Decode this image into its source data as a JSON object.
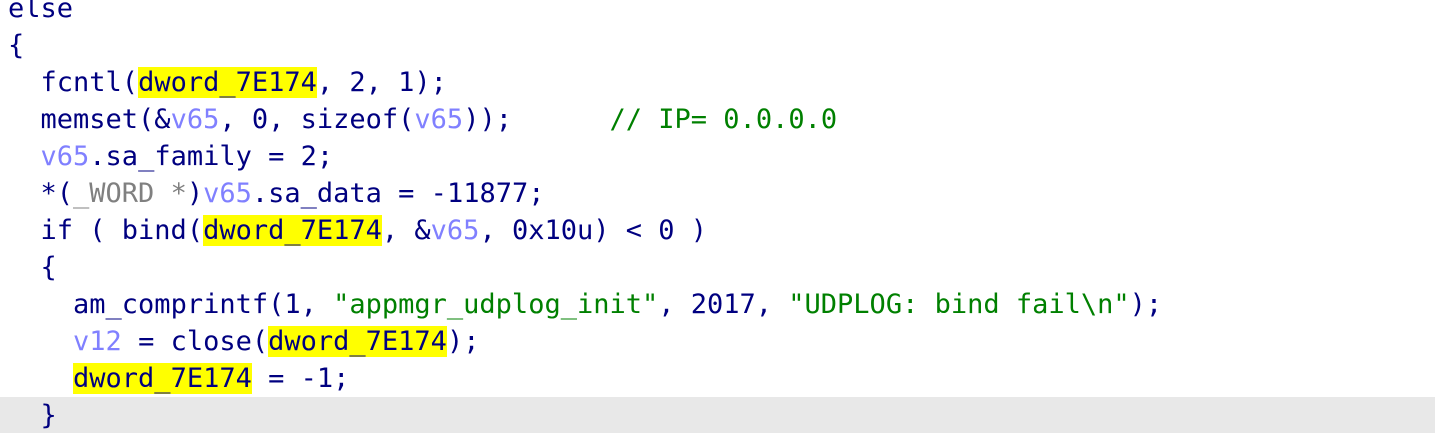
{
  "editor": {
    "lines": [
      {
        "indent": "",
        "current": false,
        "tokens": [
          {
            "text": "else",
            "kind": "ident",
            "name": "keyword-else"
          }
        ]
      },
      {
        "indent": "",
        "current": false,
        "tokens": [
          {
            "text": "{",
            "kind": "punct",
            "name": "brace-open"
          }
        ]
      },
      {
        "indent": "  ",
        "current": false,
        "tokens": [
          {
            "text": "fcntl(",
            "kind": "ident",
            "name": "call-fcntl"
          },
          {
            "text": "dword_7E174",
            "kind": "hl",
            "name": "highlighted-identifier"
          },
          {
            "text": ", 2, 1);",
            "kind": "punct",
            "name": "arguments"
          }
        ]
      },
      {
        "indent": "  ",
        "current": false,
        "tokens": [
          {
            "text": "memset(&",
            "kind": "ident",
            "name": "call-memset"
          },
          {
            "text": "v65",
            "kind": "var",
            "name": "local-variable"
          },
          {
            "text": ", 0, sizeof(",
            "kind": "punct",
            "name": "arguments"
          },
          {
            "text": "v65",
            "kind": "var",
            "name": "local-variable"
          },
          {
            "text": "));      ",
            "kind": "punct",
            "name": "statement-end"
          },
          {
            "text": "// IP= 0.0.0.0",
            "kind": "comment",
            "name": "comment"
          }
        ]
      },
      {
        "indent": "  ",
        "current": false,
        "tokens": [
          {
            "text": "v65",
            "kind": "var",
            "name": "local-variable"
          },
          {
            "text": ".sa_family = 2;",
            "kind": "ident",
            "name": "assignment"
          }
        ]
      },
      {
        "indent": "  ",
        "current": false,
        "tokens": [
          {
            "text": "*(",
            "kind": "punct",
            "name": "cast-open"
          },
          {
            "text": "_WORD *",
            "kind": "type",
            "name": "type-cast"
          },
          {
            "text": ")",
            "kind": "punct",
            "name": "cast-close"
          },
          {
            "text": "v65",
            "kind": "var",
            "name": "local-variable"
          },
          {
            "text": ".sa_data = -11877;",
            "kind": "ident",
            "name": "assignment"
          }
        ]
      },
      {
        "indent": "  ",
        "current": false,
        "tokens": [
          {
            "text": "if ( bind(",
            "kind": "ident",
            "name": "call-bind"
          },
          {
            "text": "dword_7E174",
            "kind": "hl",
            "name": "highlighted-identifier"
          },
          {
            "text": ", &",
            "kind": "punct",
            "name": "arguments"
          },
          {
            "text": "v65",
            "kind": "var",
            "name": "local-variable"
          },
          {
            "text": ", 0x10u) < 0 )",
            "kind": "punct",
            "name": "condition-end"
          }
        ]
      },
      {
        "indent": "  ",
        "current": false,
        "tokens": [
          {
            "text": "{",
            "kind": "punct",
            "name": "brace-open"
          }
        ]
      },
      {
        "indent": "    ",
        "current": false,
        "tokens": [
          {
            "text": "am_comprintf(1, ",
            "kind": "ident",
            "name": "call-am-comprintf"
          },
          {
            "text": "\"appmgr_udplog_init\"",
            "kind": "str",
            "name": "string-literal"
          },
          {
            "text": ", 2017, ",
            "kind": "punct",
            "name": "arguments"
          },
          {
            "text": "\"UDPLOG: bind fail\\n\"",
            "kind": "str",
            "name": "string-literal"
          },
          {
            "text": ");",
            "kind": "punct",
            "name": "statement-end"
          }
        ]
      },
      {
        "indent": "    ",
        "current": false,
        "tokens": [
          {
            "text": "v12",
            "kind": "var",
            "name": "local-variable"
          },
          {
            "text": " = close(",
            "kind": "ident",
            "name": "call-close"
          },
          {
            "text": "dword_7E174",
            "kind": "hl",
            "name": "highlighted-identifier"
          },
          {
            "text": ");",
            "kind": "punct",
            "name": "statement-end"
          }
        ]
      },
      {
        "indent": "    ",
        "current": false,
        "tokens": [
          {
            "text": "dword_7E174",
            "kind": "hl",
            "name": "highlighted-identifier"
          },
          {
            "text": " = -1;",
            "kind": "ident",
            "name": "assignment"
          }
        ]
      },
      {
        "indent": "  ",
        "current": true,
        "tokens": [
          {
            "text": "}",
            "kind": "punct",
            "name": "brace-close"
          }
        ]
      }
    ]
  }
}
